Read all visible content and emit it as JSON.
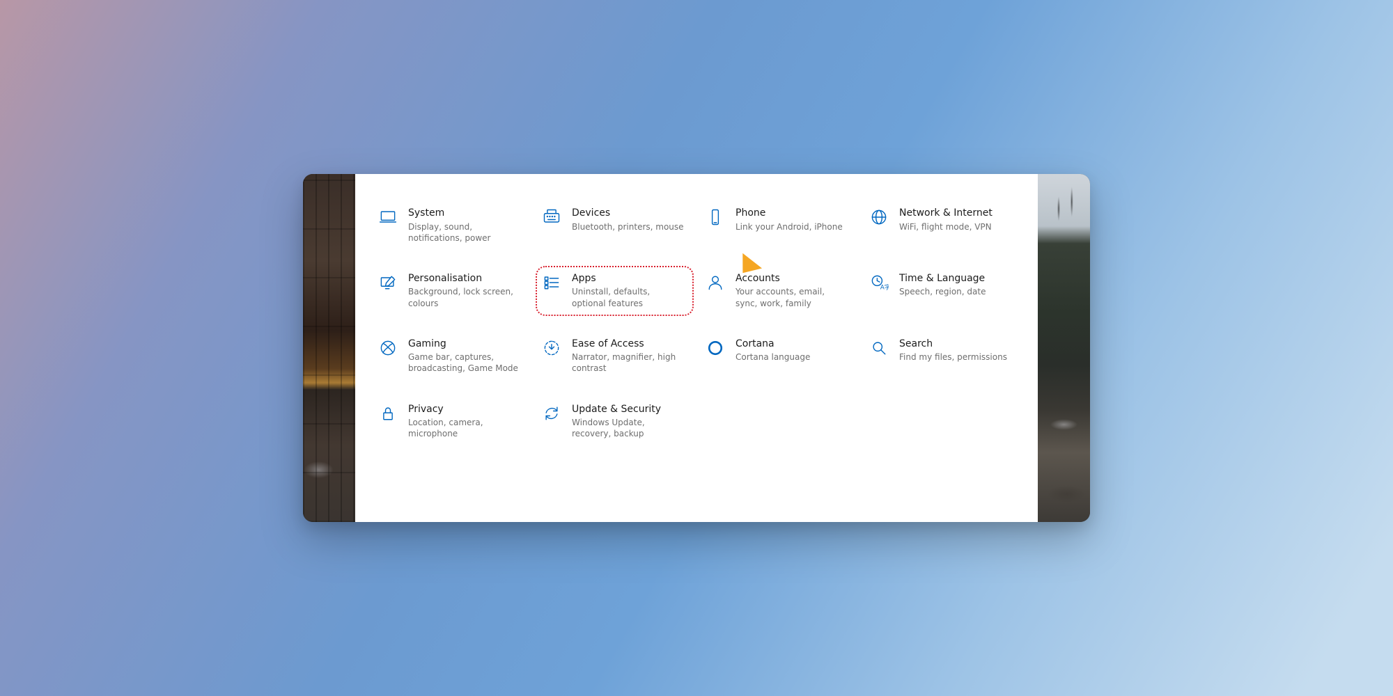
{
  "accent": "#0067c0",
  "highlight_color": "#d81e2c",
  "arrow_color": "#f5a623",
  "categories": [
    {
      "id": "system",
      "title": "System",
      "desc": "Display, sound, notifications, power",
      "icon": "laptop"
    },
    {
      "id": "devices",
      "title": "Devices",
      "desc": "Bluetooth, printers, mouse",
      "icon": "keyboard"
    },
    {
      "id": "phone",
      "title": "Phone",
      "desc": "Link your Android, iPhone",
      "icon": "phone"
    },
    {
      "id": "network",
      "title": "Network & Internet",
      "desc": "WiFi, flight mode, VPN",
      "icon": "globe"
    },
    {
      "id": "personalisation",
      "title": "Personalisation",
      "desc": "Background, lock screen, colours",
      "icon": "pen-monitor"
    },
    {
      "id": "apps",
      "title": "Apps",
      "desc": "Uninstall, defaults, optional features",
      "icon": "list",
      "highlight": true
    },
    {
      "id": "accounts",
      "title": "Accounts",
      "desc": "Your accounts, email, sync, work, family",
      "icon": "person"
    },
    {
      "id": "time-language",
      "title": "Time & Language",
      "desc": "Speech, region, date",
      "icon": "clock-lang"
    },
    {
      "id": "gaming",
      "title": "Gaming",
      "desc": "Game bar, captures, broadcasting, Game Mode",
      "icon": "xbox"
    },
    {
      "id": "ease-of-access",
      "title": "Ease of Access",
      "desc": "Narrator, magnifier, high contrast",
      "icon": "ease"
    },
    {
      "id": "cortana",
      "title": "Cortana",
      "desc": "Cortana language",
      "icon": "cortana"
    },
    {
      "id": "search",
      "title": "Search",
      "desc": "Find my files, permissions",
      "icon": "search"
    },
    {
      "id": "privacy",
      "title": "Privacy",
      "desc": "Location, camera, microphone",
      "icon": "lock"
    },
    {
      "id": "update-security",
      "title": "Update & Security",
      "desc": "Windows Update, recovery, backup",
      "icon": "sync"
    }
  ]
}
